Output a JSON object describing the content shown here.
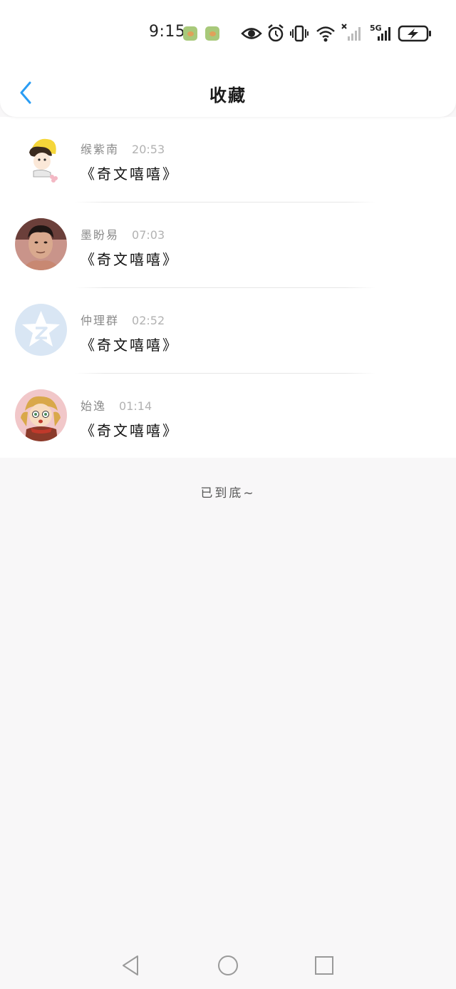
{
  "status_bar": {
    "time": "9:15",
    "network_label": "5G",
    "icons": [
      "notification-app-icon",
      "notification-app-icon",
      "eye-icon",
      "alarm-icon",
      "vibrate-icon",
      "wifi-icon",
      "no-signal-icon",
      "5g-signal-icon",
      "battery-charging-icon"
    ]
  },
  "header": {
    "title": "收藏",
    "back_icon": "chevron-left-icon",
    "accent_color": "#2a9df4"
  },
  "items": [
    {
      "name": "缑紫南",
      "time": "20:53",
      "title": "《奇文嘻嘻》",
      "avatar": "anime-boy-yellow-hat"
    },
    {
      "name": "墨盼易",
      "time": "07:03",
      "title": "《奇文嘻嘻》",
      "avatar": "man-photo"
    },
    {
      "name": "仲理群",
      "time": "02:52",
      "title": "《奇文嘻嘻》",
      "avatar": "qzone-star-logo"
    },
    {
      "name": "始逸",
      "time": "01:14",
      "title": "《奇文嘻嘻》",
      "avatar": "cartoon-girl-scarf"
    }
  ],
  "footer": {
    "end_text": "已到底~"
  },
  "system_nav": {
    "icons": [
      "back-triangle-icon",
      "home-circle-icon",
      "recents-square-icon"
    ]
  }
}
